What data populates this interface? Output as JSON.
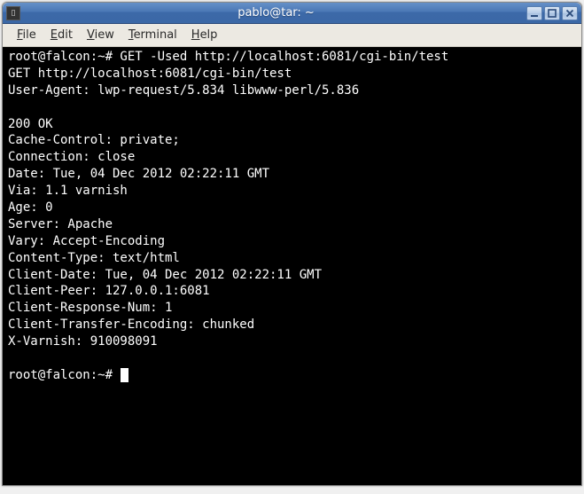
{
  "window": {
    "title": "pablo@tar: ~"
  },
  "menubar": {
    "file": "File",
    "edit": "Edit",
    "view": "View",
    "terminal": "Terminal",
    "help": "Help"
  },
  "terminal": {
    "lines": [
      "root@falcon:~# GET -Used http://localhost:6081/cgi-bin/test",
      "GET http://localhost:6081/cgi-bin/test",
      "User-Agent: lwp-request/5.834 libwww-perl/5.836",
      "",
      "200 OK",
      "Cache-Control: private;",
      "Connection: close",
      "Date: Tue, 04 Dec 2012 02:22:11 GMT",
      "Via: 1.1 varnish",
      "Age: 0",
      "Server: Apache",
      "Vary: Accept-Encoding",
      "Content-Type: text/html",
      "Client-Date: Tue, 04 Dec 2012 02:22:11 GMT",
      "Client-Peer: 127.0.0.1:6081",
      "Client-Response-Num: 1",
      "Client-Transfer-Encoding: chunked",
      "X-Varnish: 910098091",
      ""
    ],
    "prompt": "root@falcon:~# "
  }
}
